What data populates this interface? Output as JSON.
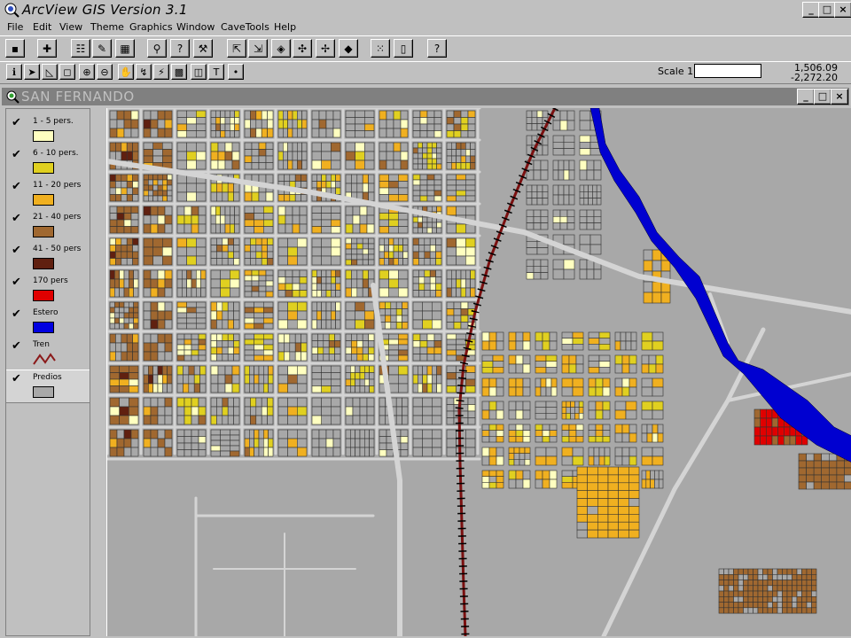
{
  "app": {
    "title": "ArcView GIS Version 3.1"
  },
  "window_controls": {
    "minimize": "_",
    "maximize": "□",
    "close": "×"
  },
  "menu": [
    "File",
    "Edit",
    "View",
    "Theme",
    "Graphics",
    "Window",
    "CaveTools",
    "Help"
  ],
  "toolbar": {
    "scale_label": "Scale 1:",
    "scale_value": "",
    "coord_x": "1,506.09",
    "coord_y": "-2,272.20"
  },
  "view": {
    "title": "SAN FERNANDO"
  },
  "legend": [
    {
      "label": "1 - 5 pers.",
      "color": "#ffffc0",
      "checked": true
    },
    {
      "label": "6 - 10 pers.",
      "color": "#e0d020",
      "checked": true
    },
    {
      "label": "11 - 20 pers",
      "color": "#f0b020",
      "checked": true
    },
    {
      "label": "21 - 40 pers",
      "color": "#a06830",
      "checked": true
    },
    {
      "label": "41 - 50 pers",
      "color": "#602010",
      "checked": true
    },
    {
      "label": "170 pers",
      "color": "#e00000",
      "checked": true
    },
    {
      "label": "Estero",
      "color": "#0000e0",
      "checked": true
    },
    {
      "label": "Tren",
      "color": "#8b1a1a",
      "checked": true
    },
    {
      "label": "Predios",
      "color": "#a8a8a8",
      "checked": true
    }
  ],
  "colors": {
    "river": "#0000d0",
    "railway": "#7a1010",
    "roads": "#d4d4d4",
    "parcel_edge": "#404040",
    "background": "#a8a8a8"
  }
}
